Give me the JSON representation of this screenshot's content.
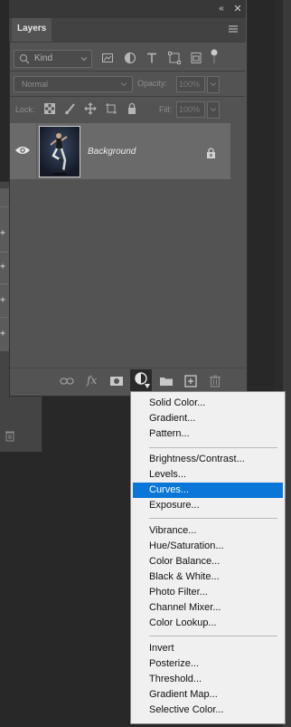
{
  "panel": {
    "tab_label": "Layers",
    "collapse_glyph": "«",
    "close_glyph": "✕",
    "filter": {
      "kind_placeholder": "Kind"
    },
    "blend_mode": "Normal",
    "opacity_label": "Opacity:",
    "opacity_value": "100%",
    "lock_label": "Lock:",
    "fill_label": "Fill:",
    "fill_value": "100%"
  },
  "layers": [
    {
      "name": "Background",
      "visible": true,
      "locked": true
    }
  ],
  "bottom_toolbar": {
    "fx_label": "fx",
    "icons": [
      "link-icon",
      "fx-icon",
      "mask-icon",
      "adjustment-icon",
      "folder-icon",
      "new-layer-icon",
      "trash-icon"
    ]
  },
  "adjustment_menu": {
    "groups": [
      [
        "Solid Color...",
        "Gradient...",
        "Pattern..."
      ],
      [
        "Brightness/Contrast...",
        "Levels...",
        "Curves...",
        "Exposure..."
      ],
      [
        "Vibrance...",
        "Hue/Saturation...",
        "Color Balance...",
        "Black & White...",
        "Photo Filter...",
        "Channel Mixer...",
        "Color Lookup..."
      ],
      [
        "Invert",
        "Posterize...",
        "Threshold...",
        "Gradient Map...",
        "Selective Color..."
      ]
    ],
    "selected": "Curves..."
  },
  "colors": {
    "highlight": "#0a76d8",
    "panel": "#535353",
    "background": "#282828"
  }
}
